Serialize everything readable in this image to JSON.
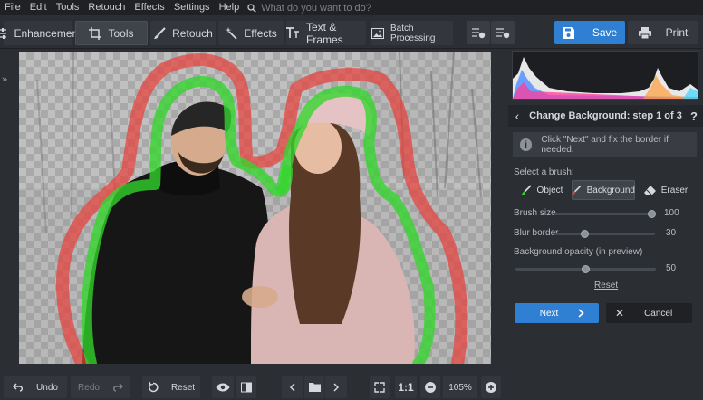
{
  "menu": [
    "File",
    "Edit",
    "Tools",
    "Retouch",
    "Effects",
    "Settings",
    "Help"
  ],
  "search": {
    "placeholder": "What do you want to do?"
  },
  "tabs": [
    {
      "label": "Enhancement",
      "icon": "sliders-icon"
    },
    {
      "label": "Tools",
      "icon": "crop-icon"
    },
    {
      "label": "Retouch",
      "icon": "brush-icon"
    },
    {
      "label": "Effects",
      "icon": "magic-wand-icon"
    },
    {
      "label": "Text & Frames",
      "icon": "text-icon"
    },
    {
      "label": "Batch Processing",
      "icon": "images-icon"
    }
  ],
  "toolbar": {
    "save_label": "Save",
    "print_label": "Print"
  },
  "panel": {
    "title": "Change Background: step 1 of 3",
    "hint": "Click \"Next\" and fix the border if needed.",
    "select_brush": "Select a brush:",
    "brushes": [
      "Object",
      "Background",
      "Eraser"
    ],
    "brush_size_label": "Brush size",
    "brush_size": 100,
    "blur_border_label": "Blur border",
    "blur_border": 30,
    "opacity_label": "Background opacity (in preview)",
    "opacity": 50,
    "reset_label": "Reset",
    "next_label": "Next",
    "cancel_label": "Cancel"
  },
  "bottom": {
    "undo_label": "Undo",
    "redo_label": "Redo",
    "reset_label": "Reset",
    "one_to_one": "1:1",
    "zoom": "105%"
  },
  "colors": {
    "accent": "#2f7fd2",
    "object_stroke": "#33d62c",
    "background_stroke": "#e8413c"
  }
}
